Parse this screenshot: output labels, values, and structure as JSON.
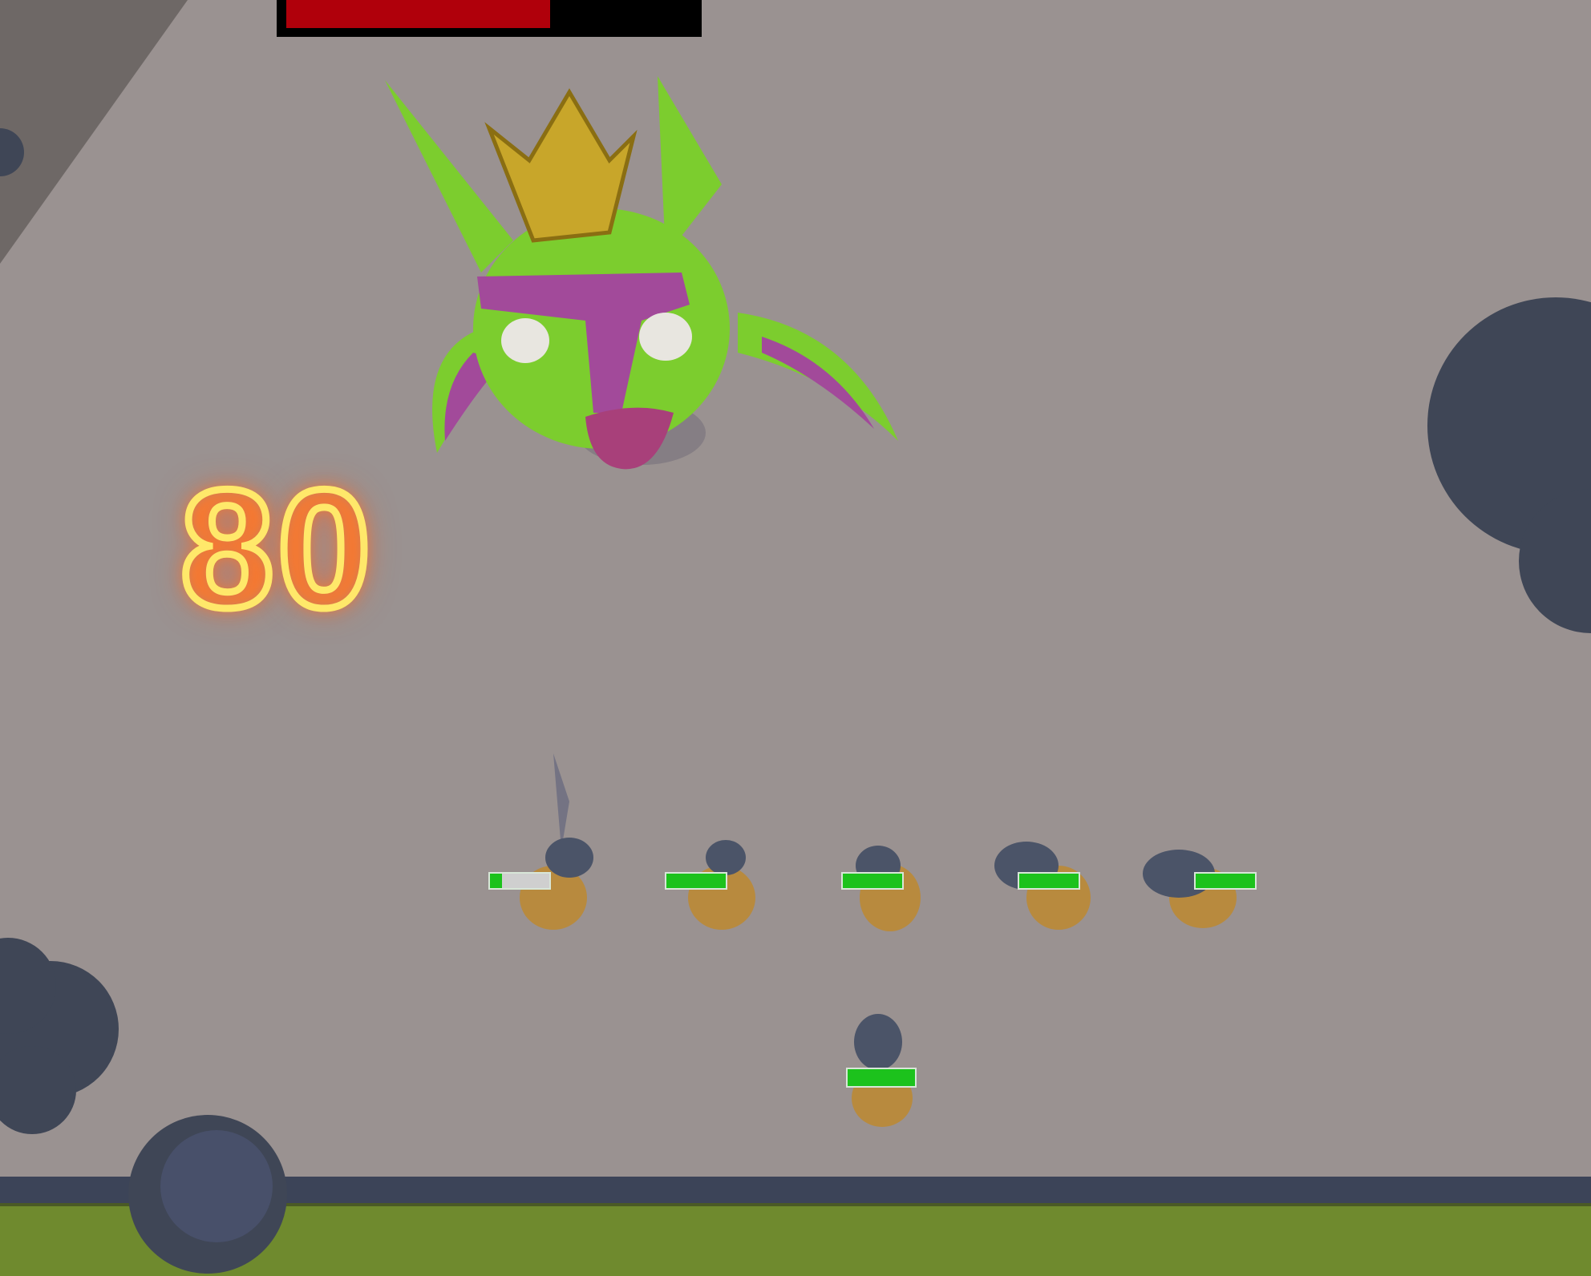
{
  "boss": {
    "name": "goblin-king",
    "health_fraction": 0.65,
    "bar_color": "#b0000b"
  },
  "damage_popup": {
    "text": "80",
    "color": "#ffe86a"
  },
  "units": [
    {
      "health_fraction": 0.2
    },
    {
      "health_fraction": 1.0
    },
    {
      "health_fraction": 1.0
    },
    {
      "health_fraction": 1.0
    },
    {
      "health_fraction": 1.0
    },
    {
      "health_fraction": 1.0
    }
  ],
  "colors": {
    "ground": "#9a9291",
    "grass": "#6f8a2e",
    "rocks": "#3f4656",
    "health": "#1cc21c"
  }
}
